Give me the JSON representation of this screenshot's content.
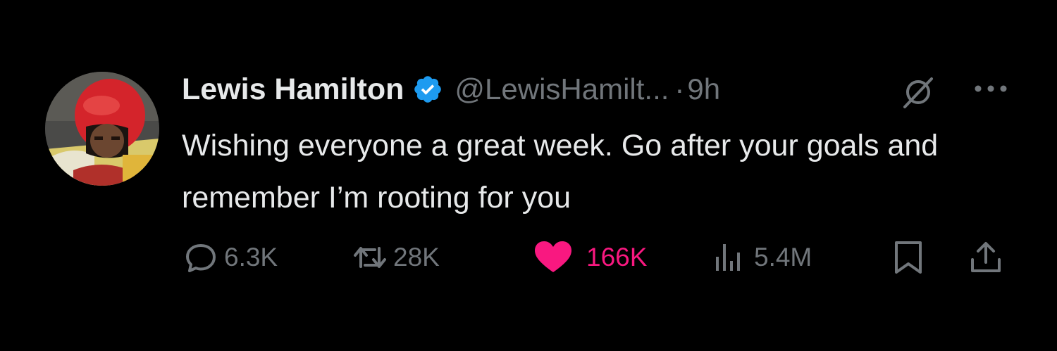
{
  "tweet": {
    "author_name": "Lewis Hamilton",
    "handle": "@LewisHamilt...",
    "separator": "·",
    "time": "9h",
    "text": "Wishing everyone a great week. Go after your goals and remember I’m rooting for you",
    "verified": true,
    "icons": {
      "avatar": "profile-photo",
      "grok": "grok-icon",
      "more": "more-icon"
    }
  },
  "actions": {
    "replies": "6.3K",
    "reposts": "28K",
    "likes": "166K",
    "views": "5.4M",
    "liked": true
  },
  "colors": {
    "background": "#000000",
    "text": "#e7e9ea",
    "muted": "#71767b",
    "verified": "#1d9bf0",
    "like": "#f91880"
  }
}
